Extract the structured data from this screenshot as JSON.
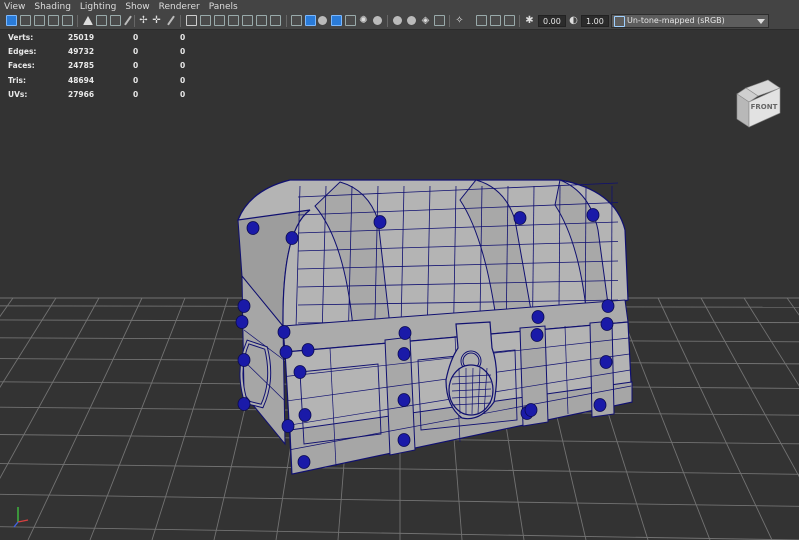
{
  "menubar": {
    "items": [
      {
        "label": "View"
      },
      {
        "label": "Shading"
      },
      {
        "label": "Lighting"
      },
      {
        "label": "Show"
      },
      {
        "label": "Renderer"
      },
      {
        "label": "Panels"
      }
    ]
  },
  "toolbar": {
    "exposure": "0.00",
    "gamma": "1.00",
    "color_space": "Un-tone-mapped (sRGB)"
  },
  "hud": {
    "rows": [
      {
        "label": "Verts:",
        "v1": "25019",
        "v2": "0",
        "v3": "0"
      },
      {
        "label": "Edges:",
        "v1": "49732",
        "v2": "0",
        "v3": "0"
      },
      {
        "label": "Faces:",
        "v1": "24785",
        "v2": "0",
        "v3": "0"
      },
      {
        "label": "Tris:",
        "v1": "48694",
        "v2": "0",
        "v3": "0"
      },
      {
        "label": "UVs:",
        "v1": "27966",
        "v2": "0",
        "v3": "0"
      }
    ]
  },
  "viewcube": {
    "face": "FRONT"
  },
  "colors": {
    "viewport_bg": "#333333",
    "grid": "#7a7a7a",
    "mesh_fill": "#b4b4b4",
    "wire": "#101070",
    "rivet": "#1a1aa8"
  }
}
